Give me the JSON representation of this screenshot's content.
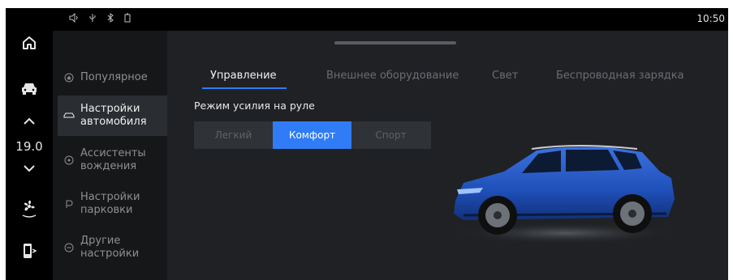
{
  "status": {
    "time": "10:50"
  },
  "rail": {
    "temperature": "19.0"
  },
  "sidebar": {
    "items": [
      {
        "line1": "Популярное",
        "line2": ""
      },
      {
        "line1": "Настройки",
        "line2": "автомобиля"
      },
      {
        "line1": "Ассистенты",
        "line2": "вождения"
      },
      {
        "line1": "Настройки",
        "line2": "парковки"
      },
      {
        "line1": "Другие",
        "line2": "настройки"
      }
    ]
  },
  "tabs": [
    {
      "label": "Управление"
    },
    {
      "label": "Внешнее оборудование"
    },
    {
      "label": "Свет"
    },
    {
      "label": "Беспроводная зарядка"
    }
  ],
  "steering": {
    "label": "Режим усилия на руле",
    "options": [
      "Легкий",
      "Комфорт",
      "Спорт"
    ],
    "selected": "Комфорт"
  },
  "colors": {
    "accent": "#2f7cf6",
    "car_body": "#1f4fb8"
  },
  "icons": [
    "home-icon",
    "car-icon",
    "chevron-up-icon",
    "chevron-down-icon",
    "fan-icon",
    "phone-icon",
    "volume-icon",
    "usb-icon",
    "bluetooth-icon",
    "battery-icon",
    "star-icon",
    "car-outline-icon",
    "steering-assist-icon",
    "parking-icon",
    "more-icon"
  ]
}
